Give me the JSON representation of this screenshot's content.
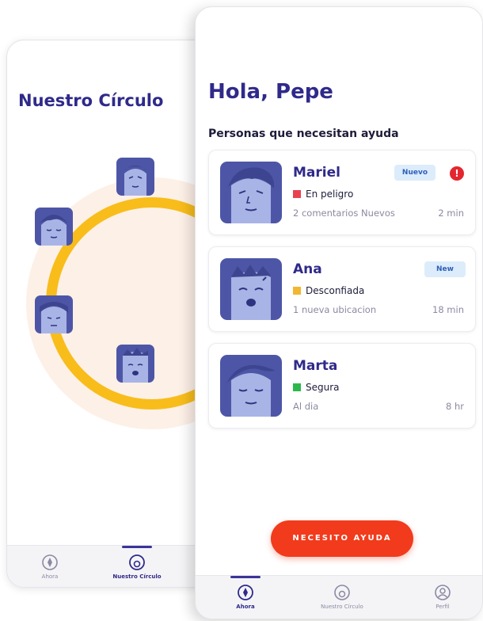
{
  "back_screen": {
    "title": "Nuestro Círculo",
    "nav": [
      {
        "label": "Ahora",
        "icon": "compass-icon",
        "active": false
      },
      {
        "label": "Nuestro Círculo",
        "icon": "circle-icon",
        "active": true
      }
    ]
  },
  "front_screen": {
    "greeting": "Hola, Pepe",
    "section_title": "Personas que necesitan ayuda",
    "people": [
      {
        "name": "Mariel",
        "badge": "Nuevo",
        "alert": "!",
        "status": "En peligro",
        "status_color": "#e8414d",
        "detail": "2 comentarios Nuevos",
        "time": "2 min"
      },
      {
        "name": "Ana",
        "badge": "New",
        "status": "Desconfiada",
        "status_color": "#f2b632",
        "detail": "1 nueva ubicacion",
        "time": "18 min"
      },
      {
        "name": "Marta",
        "status": "Segura",
        "status_color": "#2bb84a",
        "detail": "Al dia",
        "time": "8 hr"
      }
    ],
    "cta_label": "NECESITO AYUDA",
    "nav": [
      {
        "label": "Ahora",
        "icon": "compass-icon",
        "active": true
      },
      {
        "label": "Nuestro Círculo",
        "icon": "circle-icon",
        "active": false
      },
      {
        "label": "Perfil",
        "icon": "user-icon",
        "active": false
      }
    ]
  },
  "colors": {
    "brand": "#2f2a8a",
    "accent": "#f13b1c",
    "ring": "#f8bd1b",
    "face_bg": "#4d56a6",
    "face_skin": "#a9b4e6"
  }
}
